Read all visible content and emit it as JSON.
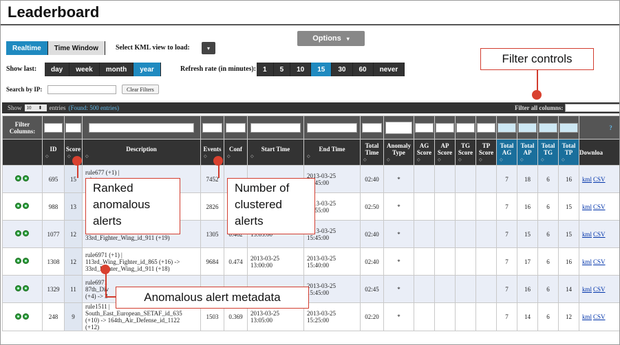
{
  "title": "Leaderboard",
  "view_modes": [
    "Realtime",
    "Time Window"
  ],
  "kml_label": "Select KML view to load:",
  "kml_arrow": "▾",
  "options_label": "Options",
  "options_arrow": "▾",
  "show_last_label": "Show last:",
  "periods": [
    "day",
    "week",
    "month",
    "year"
  ],
  "refresh_label": "Refresh rate (in minutes):",
  "refresh_rates": [
    "1",
    "5",
    "10",
    "15",
    "30",
    "60",
    "never"
  ],
  "search_label": "Search by IP:",
  "search_value": "",
  "clear_filters": "Clear Filters",
  "table_bar": {
    "show": "Show",
    "entries_value": "10",
    "entries": "entries",
    "found": "(Found: 500 entries)",
    "filter_all": "Filter all columns:"
  },
  "filter_columns_label": "Filter Columns:",
  "filter_help_icon": "?",
  "columns": [
    "ID",
    "Score",
    "Description",
    "Events",
    "Conf",
    "Start Time",
    "End Time",
    "Total Time",
    "Anomaly Type",
    "AG Score",
    "AP Score",
    "TG Score",
    "TP Score",
    "Total AG",
    "Total AP",
    "Total TG",
    "Total TP",
    "Downloa"
  ],
  "sort_glyph": "◇",
  "rows": [
    {
      "id": "695",
      "score": "15",
      "desc": "rule677 (+1) |\n...) ->\n..._id_953",
      "events": "7452",
      "conf": "",
      "start": "",
      "end": "2013-03-25\n13:45:00",
      "total": "02:40",
      "anom": "*",
      "ag": "7",
      "ap": "18",
      "tg": "6",
      "tp": "16",
      "kml": "kml",
      "csv": "CSV"
    },
    {
      "id": "988",
      "score": "13",
      "desc": "...0\n...11",
      "events": "2826",
      "conf": "",
      "start": "",
      "end": "2013-03-25\n15:55:00",
      "total": "02:50",
      "anom": "*",
      "ag": "7",
      "ap": "16",
      "tg": "6",
      "tp": "15",
      "kml": "kml",
      "csv": "CSV"
    },
    {
      "id": "1077",
      "score": "12",
      "desc": "113rd_Wing_Fighter_id_865 (+15) ->\n33rd_Fighter_Wing_id_911 (+19)",
      "events": "1305",
      "conf": "0.462",
      "start": "13:05:00",
      "end": "2013-03-25\n15:45:00",
      "total": "02:40",
      "anom": "*",
      "ag": "7",
      "ap": "15",
      "tg": "6",
      "tp": "15",
      "kml": "kml",
      "csv": "CSV"
    },
    {
      "id": "1308",
      "score": "12",
      "desc": "rule6971 (+1) |\n113rd_Wing_Fighter_id_865 (+16) ->\n33rd_Fighter_Wing_id_911 (+18)",
      "events": "9684",
      "conf": "0.474",
      "start": "2013-03-25\n13:00:00",
      "end": "2013-03-25\n15:40:00",
      "total": "02:40",
      "anom": "*",
      "ag": "7",
      "ap": "17",
      "tg": "6",
      "tp": "16",
      "kml": "kml",
      "csv": "CSV"
    },
    {
      "id": "1329",
      "score": "11",
      "desc": "rule6971\n87th_Div\n(+4) -> 3",
      "events": "",
      "conf": "",
      "start": "",
      "end": "2013-03-25\n15:45:00",
      "total": "02:45",
      "anom": "*",
      "ag": "7",
      "ap": "16",
      "tg": "6",
      "tp": "14",
      "kml": "kml",
      "csv": "CSV"
    },
    {
      "id": "248",
      "score": "9",
      "desc": "rule1511 |\nSouth_East_European_SETAF_id_635\n(+10) -> 164th_Air_Defense_id_1122\n(+12)",
      "events": "1503",
      "conf": "0.369",
      "start": "2013-03-25\n13:05:00",
      "end": "2013-03-25\n15:25:00",
      "total": "02:20",
      "anom": "*",
      "ag": "7",
      "ap": "14",
      "tg": "6",
      "tp": "12",
      "kml": "kml",
      "csv": "CSV"
    }
  ],
  "callouts": {
    "filter": "Filter controls",
    "ranked": "Ranked\nanomalous\nalerts",
    "clustered": "Number of\nclustered\nalerts",
    "metadata": "Anomalous alert metadata"
  },
  "colors": {
    "accent": "#1f8ac0",
    "callout": "#d23c2e",
    "marker": "#d9412f",
    "status_green": "#2f9e3a"
  }
}
